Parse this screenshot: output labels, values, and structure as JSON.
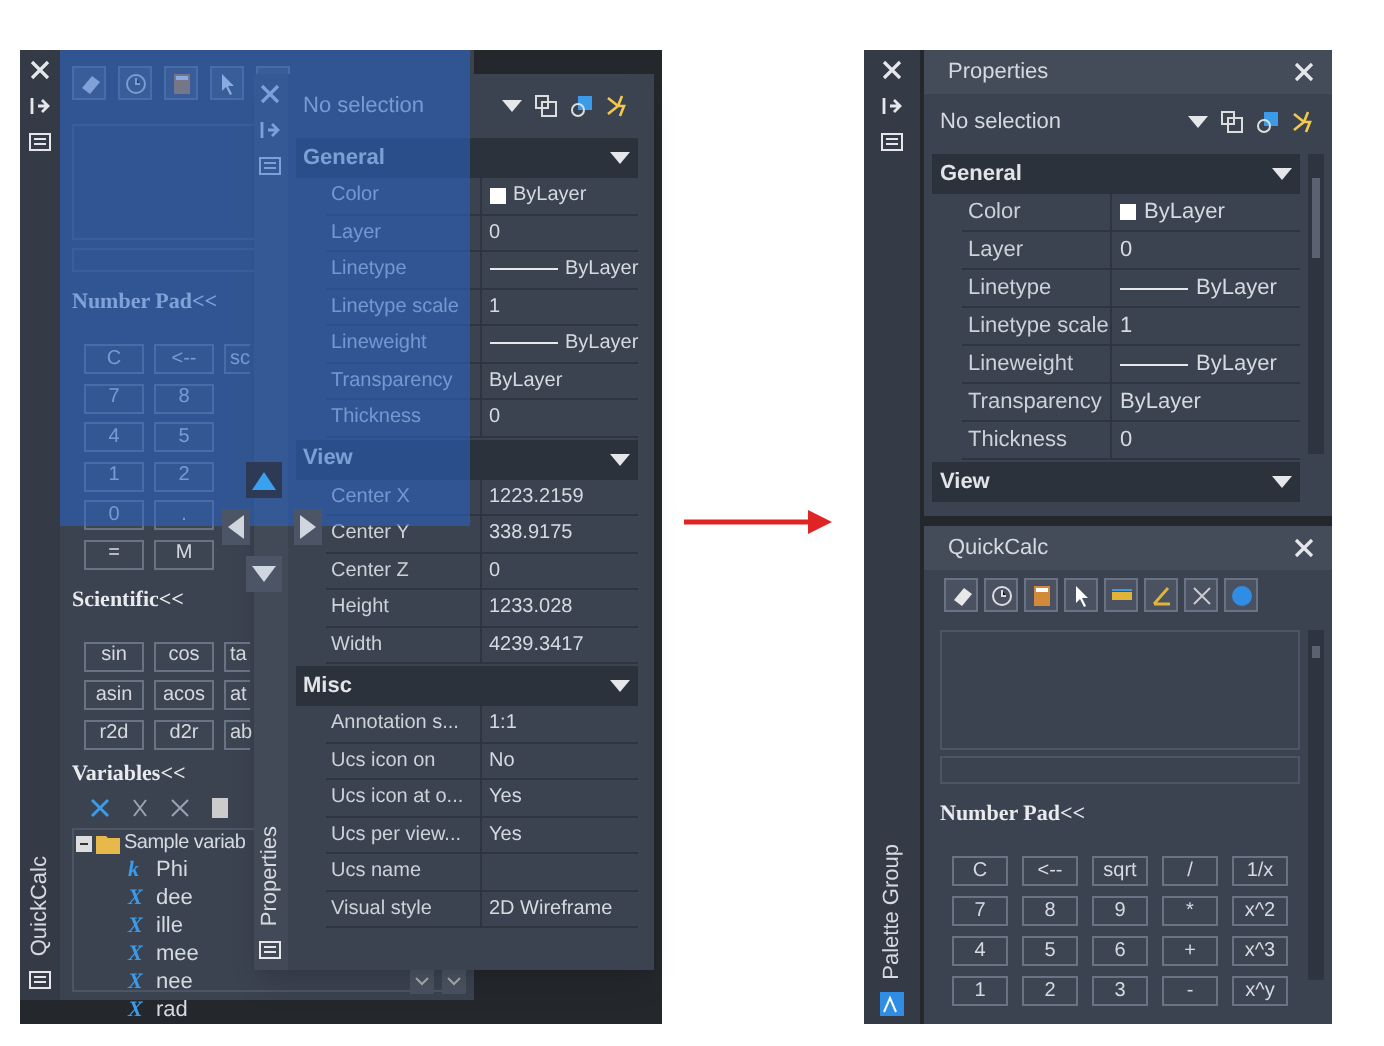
{
  "left_view": {
    "quickcalc": {
      "side_title": "QuickCalc",
      "number_pad": {
        "heading": "Number Pad<<",
        "keys": [
          [
            "C",
            "<--",
            "sc"
          ],
          [
            "7",
            "8"
          ],
          [
            "4",
            "5"
          ],
          [
            "1",
            "2"
          ],
          [
            "0",
            "."
          ],
          [
            "=",
            "M"
          ]
        ]
      },
      "scientific": {
        "heading": "Scientific<<",
        "keys": [
          [
            "sin",
            "cos",
            "ta"
          ],
          [
            "asin",
            "acos",
            "at"
          ],
          [
            "r2d",
            "d2r",
            "ab"
          ]
        ]
      },
      "variables": {
        "heading": "Variables<<",
        "tree": [
          {
            "label": "Sample variab",
            "expanded": true,
            "children": [
              {
                "symbol": "k",
                "label": "Phi"
              },
              {
                "symbol": "X",
                "label": "dee"
              },
              {
                "symbol": "X",
                "label": "ille"
              },
              {
                "symbol": "X",
                "label": "mee"
              },
              {
                "symbol": "X",
                "label": "nee"
              },
              {
                "symbol": "X",
                "label": "rad"
              }
            ]
          }
        ]
      }
    },
    "properties": {
      "side_title": "Properties",
      "selection": "No selection",
      "sections": [
        {
          "title": "General",
          "rows": [
            {
              "label": "Color",
              "value": "ByLayer",
              "kind": "swatch"
            },
            {
              "label": "Layer",
              "value": "0",
              "kind": "text"
            },
            {
              "label": "Linetype",
              "value": "ByLayer",
              "kind": "line"
            },
            {
              "label": "Linetype scale",
              "value": "1",
              "kind": "text"
            },
            {
              "label": "Lineweight",
              "value": "ByLayer",
              "kind": "line"
            },
            {
              "label": "Transparency",
              "value": "ByLayer",
              "kind": "text"
            },
            {
              "label": "Thickness",
              "value": "0",
              "kind": "text"
            }
          ]
        },
        {
          "title": "View",
          "rows": [
            {
              "label": "Center X",
              "value": "1223.2159",
              "kind": "text"
            },
            {
              "label": "Center Y",
              "value": "338.9175",
              "kind": "text"
            },
            {
              "label": "Center Z",
              "value": "0",
              "kind": "text"
            },
            {
              "label": "Height",
              "value": "1233.028",
              "kind": "text"
            },
            {
              "label": "Width",
              "value": "4239.3417",
              "kind": "text"
            }
          ]
        },
        {
          "title": "Misc",
          "rows": [
            {
              "label": "Annotation s...",
              "value": "1:1",
              "kind": "text"
            },
            {
              "label": "Ucs icon on",
              "value": "No",
              "kind": "text"
            },
            {
              "label": "Ucs icon at o...",
              "value": "Yes",
              "kind": "text"
            },
            {
              "label": "Ucs per view...",
              "value": "Yes",
              "kind": "text"
            },
            {
              "label": "Ucs name",
              "kind": "text"
            },
            {
              "label": "Visual style",
              "value": "2D Wireframe",
              "kind": "text"
            }
          ]
        }
      ]
    }
  },
  "right_view": {
    "side_title": "Palette Group",
    "properties": {
      "title": "Properties",
      "selection": "No selection",
      "sections": [
        {
          "title": "General",
          "rows": [
            {
              "label": "Color",
              "value": "ByLayer",
              "kind": "swatch"
            },
            {
              "label": "Layer",
              "value": "0",
              "kind": "text"
            },
            {
              "label": "Linetype",
              "value": "ByLayer",
              "kind": "line"
            },
            {
              "label": "Linetype scale",
              "value": "1",
              "kind": "text"
            },
            {
              "label": "Lineweight",
              "value": "ByLayer",
              "kind": "line"
            },
            {
              "label": "Transparency",
              "value": "ByLayer",
              "kind": "text"
            },
            {
              "label": "Thickness",
              "value": "0",
              "kind": "text"
            }
          ]
        },
        {
          "title": "View"
        }
      ]
    },
    "quickcalc": {
      "title": "QuickCalc",
      "number_pad": {
        "heading": "Number Pad<<",
        "keys": [
          [
            "C",
            "<--",
            "sqrt",
            "/",
            "1/x"
          ],
          [
            "7",
            "8",
            "9",
            "*",
            "x^2"
          ],
          [
            "4",
            "5",
            "6",
            "+",
            "x^3"
          ],
          [
            "1",
            "2",
            "3",
            "-",
            "x^y"
          ]
        ]
      }
    }
  }
}
